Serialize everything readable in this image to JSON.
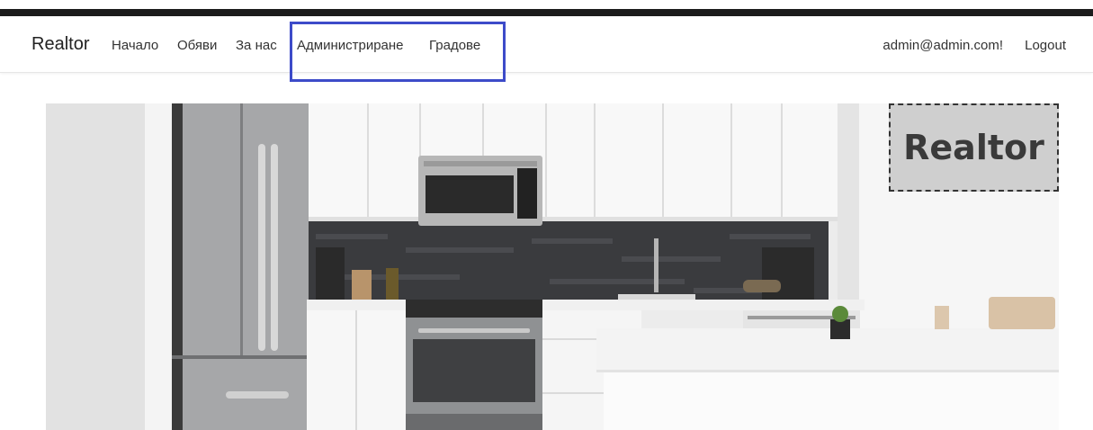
{
  "navbar": {
    "brand": "Realtor",
    "links": [
      {
        "label": "Начало"
      },
      {
        "label": "Обяви"
      },
      {
        "label": "За нас"
      },
      {
        "label": "Администриране"
      },
      {
        "label": "Градове"
      }
    ],
    "user_email": "admin@admin.com!",
    "logout_label": "Logout"
  },
  "hero": {
    "badge_text": "Realtor",
    "image_icon": "kitchen-photo"
  },
  "colors": {
    "highlight": "#3d4bc9",
    "top_bar": "#1c1c1c",
    "badge_bg": "#cfcfcf"
  }
}
